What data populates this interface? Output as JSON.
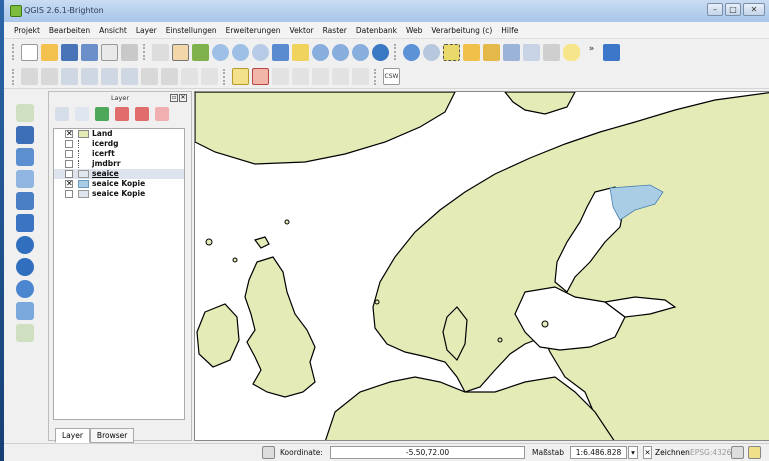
{
  "window": {
    "title": "QGIS 2.6.1-Brighton",
    "buttons": {
      "minimize": "–",
      "maximize": "□",
      "close": "✕"
    }
  },
  "menu": [
    "Projekt",
    "Bearbeiten",
    "Ansicht",
    "Layer",
    "Einstellungen",
    "Erweiterungen",
    "Vektor",
    "Raster",
    "Datenbank",
    "Web",
    "Verarbeitung (c)",
    "Hilfe"
  ],
  "toolbar2": {
    "csw_label": "CSW"
  },
  "layers_panel": {
    "title": "Layer",
    "items": [
      {
        "name": "Land",
        "checked": "✕",
        "swatch": "#e4ebb6"
      },
      {
        "name": "icerdg",
        "checked": "",
        "swatch": ""
      },
      {
        "name": "icerft",
        "checked": "",
        "swatch": ""
      },
      {
        "name": "jmdbrr",
        "checked": "",
        "swatch": ""
      },
      {
        "name": "seaice",
        "checked": "",
        "swatch": "#dfe6ee"
      },
      {
        "name": "seaice Kopie",
        "checked": "✕",
        "swatch": "#a9cde5"
      },
      {
        "name": "seaice Kopie",
        "checked": "",
        "swatch": "#dfe6ee"
      }
    ],
    "tabs": [
      "Layer",
      "Browser"
    ]
  },
  "map": {
    "land_color": "#e4ebb6",
    "ice_color": "#a9cde5",
    "sea_color": "#ffffff"
  },
  "status": {
    "coord_label": "Koordinate:",
    "coord_value": "-5.50,72.00",
    "scale_label": "Maßstab",
    "scale_value": "1:6.486.828",
    "render_label": "Zeichnen",
    "render_checked": "✕",
    "crs": "EPSG:4326"
  }
}
